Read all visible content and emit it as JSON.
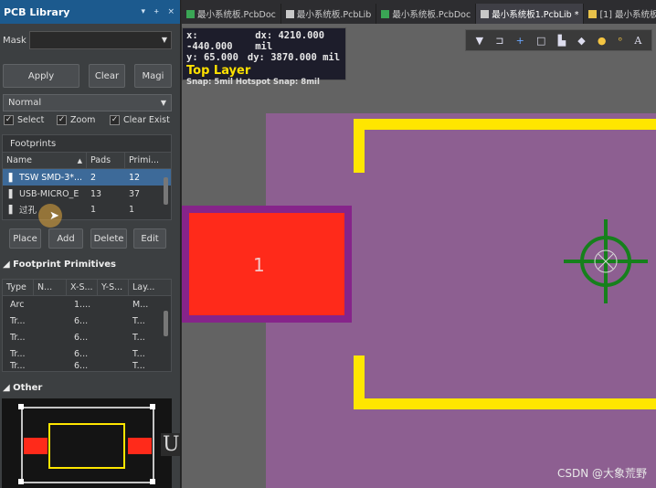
{
  "panel": {
    "title": "PCB Library",
    "ctrl_dropdown": "▾",
    "ctrl_pin": "ᚐ",
    "ctrl_close": "×",
    "mask_label": "Mask",
    "mask_value": "",
    "buttons": {
      "apply": "Apply",
      "clear": "Clear",
      "magnify": "Magi"
    },
    "mode_select": "Normal",
    "checks": {
      "select": "Select",
      "zoom": "Zoom",
      "clear_existing": "Clear Exist"
    },
    "footprints": {
      "header": "Footprints",
      "columns": [
        "Name",
        "Pads",
        "Primi..."
      ],
      "rows": [
        {
          "name": "TSW SMD-3*...",
          "pads": "2",
          "prims": "12"
        },
        {
          "name": "USB-MICRO_E",
          "pads": "13",
          "prims": "37"
        },
        {
          "name": "过孔",
          "pads": "1",
          "prims": "1"
        }
      ]
    },
    "fp_buttons": {
      "place": "Place",
      "add": "Add",
      "delete": "Delete",
      "edit": "Edit"
    },
    "primitives": {
      "header": "Footprint Primitives",
      "columns": [
        "Type",
        "N...",
        "X-S...",
        "Y-S...",
        "Lay..."
      ],
      "rows": [
        {
          "type": "Arc",
          "n": "",
          "x": "1....",
          "y": "",
          "layer": "M..."
        },
        {
          "type": "Tr...",
          "n": "",
          "x": "6...",
          "y": "",
          "layer": "T..."
        },
        {
          "type": "Tr...",
          "n": "",
          "x": "6...",
          "y": "",
          "layer": "T..."
        },
        {
          "type": "Tr...",
          "n": "",
          "x": "6...",
          "y": "",
          "layer": "T..."
        },
        {
          "type": "Tr...",
          "n": "",
          "x": "6...",
          "y": "",
          "layer": "T..."
        }
      ]
    },
    "other": {
      "header": "Other",
      "preview_label": "Up"
    }
  },
  "tabs": [
    {
      "label": "最小系统板.PcbDoc",
      "active": false
    },
    {
      "label": "最小系统板.PcbLib",
      "active": false
    },
    {
      "label": "最小系统板.PcbDoc",
      "active": false
    },
    {
      "label": "最小系统板1.PcbLib *",
      "active": true
    },
    {
      "label": "[1] 最小系统板",
      "active": false
    }
  ],
  "coords": {
    "x": "x:  -440.000",
    "dx": "dx:  4210.000 mil",
    "y": "y:   65.000",
    "dy": "dy:  3870.000 mil",
    "layer": "Top Layer",
    "snap": "Snap: 5mil Hotspot Snap: 8mil"
  },
  "toolbar_icons": [
    "filter-icon",
    "route-icon",
    "plus-icon",
    "rect-icon",
    "chart-icon",
    "paint-icon",
    "circle-icon",
    "key-icon",
    "text-icon"
  ],
  "toolbar_glyphs": [
    "▼",
    "⊐",
    "+",
    "□",
    "▙",
    "◆",
    "●",
    "ᵒ",
    "A"
  ],
  "pad_label": "1",
  "watermark": "CSDN @大象荒野",
  "colors": {
    "pad": "#ff2a1a",
    "outline": "#ffe600",
    "selection": "#3d6a99",
    "board": "#8d5f91",
    "origin": "#16801c"
  }
}
